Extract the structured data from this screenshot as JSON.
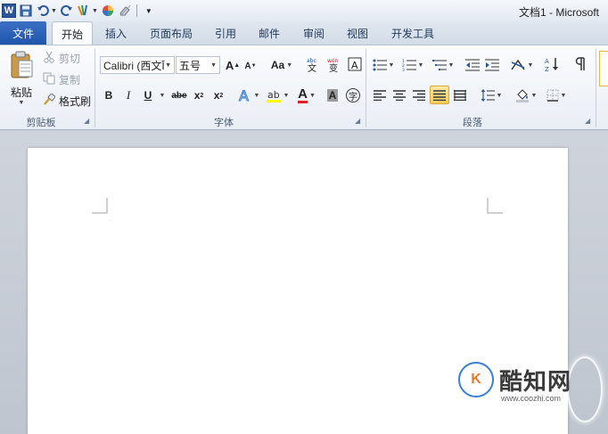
{
  "title_bar": {
    "doc_title": "文档1 - Microsoft",
    "qat_icons": [
      "word-logo",
      "save-icon",
      "undo-icon",
      "redo-icon",
      "format-painter-icon",
      "color-wheel-icon",
      "eraser-icon",
      "customize-qat-icon"
    ],
    "word_logo_letter": "W"
  },
  "tabs": {
    "file": "文件",
    "items": [
      "开始",
      "插入",
      "页面布局",
      "引用",
      "邮件",
      "审阅",
      "视图",
      "开发工具"
    ],
    "active": "开始"
  },
  "clipboard": {
    "paste": "粘贴",
    "cut": "剪切",
    "copy": "复制",
    "format_painter": "格式刷",
    "group": "剪贴板"
  },
  "font": {
    "font_name": "Calibri (西文Ī",
    "font_size": "五号",
    "grow": "A",
    "shrink": "A",
    "change_case": "Aa",
    "bold": "B",
    "italic": "I",
    "underline": "U",
    "strike": "abe",
    "subscript": "x",
    "superscript": "x",
    "subscript_mark": "2",
    "superscript_mark": "2",
    "font_color_letter": "A",
    "char_shading_letter": "A",
    "enclose": "字",
    "group": "字体"
  },
  "paragraph": {
    "group": "段落"
  },
  "colors": {
    "accent_blue": "#2b579a",
    "file_tab": "#1f56ac",
    "highlight_yellow": "#ffff00",
    "font_color_red": "#e02020",
    "active_button": "#f9cd5c"
  },
  "watermark": {
    "name": "酷知网",
    "url": "www.coozhi.com",
    "logo_letters": "ICK"
  }
}
